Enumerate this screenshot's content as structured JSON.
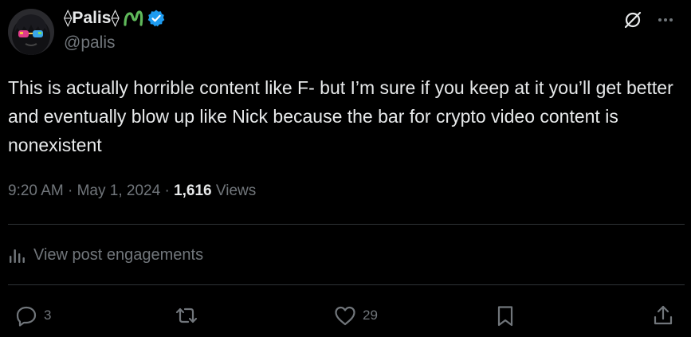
{
  "post": {
    "author": {
      "display_name": "⟠Palis⟠",
      "handle": "@palis",
      "verified_badge_color": "#1d9bf0",
      "emoji_color": "#5fb85a"
    },
    "text": "This is actually horrible content like F- but I’m sure if you keep at it you’ll get better and eventually blow up like Nick because the bar for crypto video content is nonexistent",
    "time": "9:20 AM",
    "date": "May 1, 2024",
    "separator": "·",
    "views_count": "1,616",
    "views_label": "Views",
    "engagements_label": "View post engagements"
  },
  "actions": {
    "replies": "3",
    "likes": "29"
  },
  "icons": {
    "grok": "grok-icon",
    "more": "more-icon",
    "analytics": "analytics-icon",
    "reply": "reply-icon",
    "repost": "repost-icon",
    "like": "like-icon",
    "bookmark": "bookmark-icon",
    "share": "share-icon"
  },
  "colors": {
    "background": "#000000",
    "text_primary": "#e7e9ea",
    "text_secondary": "#71767b",
    "divider": "#2f3336"
  }
}
